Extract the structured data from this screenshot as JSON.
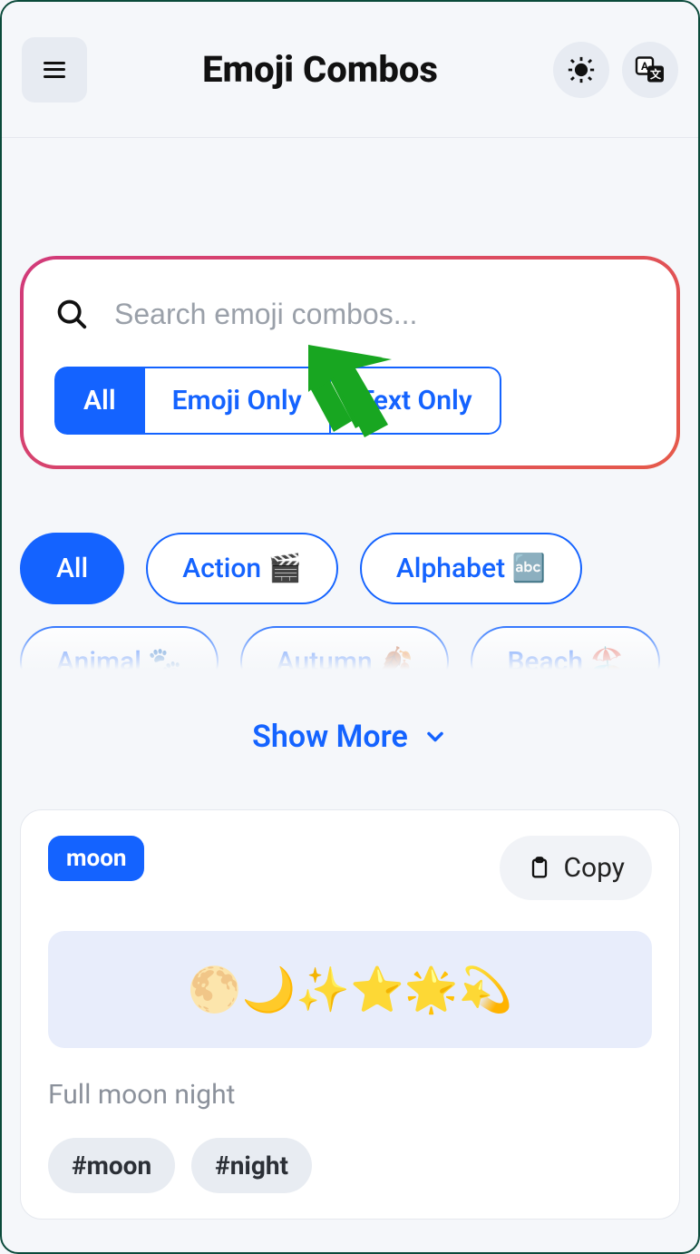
{
  "header": {
    "title": "Emoji Combos"
  },
  "search": {
    "placeholder": "Search emoji combos...",
    "value": "",
    "segments": {
      "all": "All",
      "emoji": "Emoji Only",
      "text": "Text Only"
    }
  },
  "categories": {
    "items": [
      {
        "label": "All",
        "active": true
      },
      {
        "label": "Action 🎬",
        "active": false
      },
      {
        "label": "Alphabet 🔤",
        "active": false
      },
      {
        "label": "Animal 🐾",
        "active": false
      },
      {
        "label": "Autumn 🍂",
        "active": false
      },
      {
        "label": "Beach 🏖️",
        "active": false
      }
    ],
    "show_more": "Show More"
  },
  "combo": {
    "badge": "moon",
    "copy_label": "Copy",
    "emoji_string": "🌕🌙✨⭐🌟💫",
    "description": "Full moon night",
    "tags": [
      "#moon",
      "#night"
    ]
  }
}
